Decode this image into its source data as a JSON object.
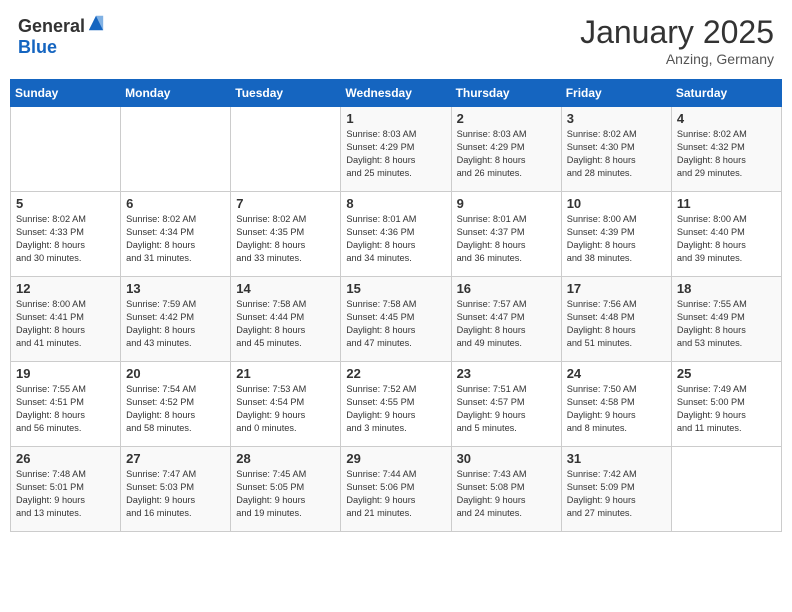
{
  "header": {
    "logo_general": "General",
    "logo_blue": "Blue",
    "month": "January 2025",
    "location": "Anzing, Germany"
  },
  "weekdays": [
    "Sunday",
    "Monday",
    "Tuesday",
    "Wednesday",
    "Thursday",
    "Friday",
    "Saturday"
  ],
  "weeks": [
    [
      {
        "day": "",
        "text": ""
      },
      {
        "day": "",
        "text": ""
      },
      {
        "day": "",
        "text": ""
      },
      {
        "day": "1",
        "text": "Sunrise: 8:03 AM\nSunset: 4:29 PM\nDaylight: 8 hours\nand 25 minutes."
      },
      {
        "day": "2",
        "text": "Sunrise: 8:03 AM\nSunset: 4:29 PM\nDaylight: 8 hours\nand 26 minutes."
      },
      {
        "day": "3",
        "text": "Sunrise: 8:02 AM\nSunset: 4:30 PM\nDaylight: 8 hours\nand 28 minutes."
      },
      {
        "day": "4",
        "text": "Sunrise: 8:02 AM\nSunset: 4:32 PM\nDaylight: 8 hours\nand 29 minutes."
      }
    ],
    [
      {
        "day": "5",
        "text": "Sunrise: 8:02 AM\nSunset: 4:33 PM\nDaylight: 8 hours\nand 30 minutes."
      },
      {
        "day": "6",
        "text": "Sunrise: 8:02 AM\nSunset: 4:34 PM\nDaylight: 8 hours\nand 31 minutes."
      },
      {
        "day": "7",
        "text": "Sunrise: 8:02 AM\nSunset: 4:35 PM\nDaylight: 8 hours\nand 33 minutes."
      },
      {
        "day": "8",
        "text": "Sunrise: 8:01 AM\nSunset: 4:36 PM\nDaylight: 8 hours\nand 34 minutes."
      },
      {
        "day": "9",
        "text": "Sunrise: 8:01 AM\nSunset: 4:37 PM\nDaylight: 8 hours\nand 36 minutes."
      },
      {
        "day": "10",
        "text": "Sunrise: 8:00 AM\nSunset: 4:39 PM\nDaylight: 8 hours\nand 38 minutes."
      },
      {
        "day": "11",
        "text": "Sunrise: 8:00 AM\nSunset: 4:40 PM\nDaylight: 8 hours\nand 39 minutes."
      }
    ],
    [
      {
        "day": "12",
        "text": "Sunrise: 8:00 AM\nSunset: 4:41 PM\nDaylight: 8 hours\nand 41 minutes."
      },
      {
        "day": "13",
        "text": "Sunrise: 7:59 AM\nSunset: 4:42 PM\nDaylight: 8 hours\nand 43 minutes."
      },
      {
        "day": "14",
        "text": "Sunrise: 7:58 AM\nSunset: 4:44 PM\nDaylight: 8 hours\nand 45 minutes."
      },
      {
        "day": "15",
        "text": "Sunrise: 7:58 AM\nSunset: 4:45 PM\nDaylight: 8 hours\nand 47 minutes."
      },
      {
        "day": "16",
        "text": "Sunrise: 7:57 AM\nSunset: 4:47 PM\nDaylight: 8 hours\nand 49 minutes."
      },
      {
        "day": "17",
        "text": "Sunrise: 7:56 AM\nSunset: 4:48 PM\nDaylight: 8 hours\nand 51 minutes."
      },
      {
        "day": "18",
        "text": "Sunrise: 7:55 AM\nSunset: 4:49 PM\nDaylight: 8 hours\nand 53 minutes."
      }
    ],
    [
      {
        "day": "19",
        "text": "Sunrise: 7:55 AM\nSunset: 4:51 PM\nDaylight: 8 hours\nand 56 minutes."
      },
      {
        "day": "20",
        "text": "Sunrise: 7:54 AM\nSunset: 4:52 PM\nDaylight: 8 hours\nand 58 minutes."
      },
      {
        "day": "21",
        "text": "Sunrise: 7:53 AM\nSunset: 4:54 PM\nDaylight: 9 hours\nand 0 minutes."
      },
      {
        "day": "22",
        "text": "Sunrise: 7:52 AM\nSunset: 4:55 PM\nDaylight: 9 hours\nand 3 minutes."
      },
      {
        "day": "23",
        "text": "Sunrise: 7:51 AM\nSunset: 4:57 PM\nDaylight: 9 hours\nand 5 minutes."
      },
      {
        "day": "24",
        "text": "Sunrise: 7:50 AM\nSunset: 4:58 PM\nDaylight: 9 hours\nand 8 minutes."
      },
      {
        "day": "25",
        "text": "Sunrise: 7:49 AM\nSunset: 5:00 PM\nDaylight: 9 hours\nand 11 minutes."
      }
    ],
    [
      {
        "day": "26",
        "text": "Sunrise: 7:48 AM\nSunset: 5:01 PM\nDaylight: 9 hours\nand 13 minutes."
      },
      {
        "day": "27",
        "text": "Sunrise: 7:47 AM\nSunset: 5:03 PM\nDaylight: 9 hours\nand 16 minutes."
      },
      {
        "day": "28",
        "text": "Sunrise: 7:45 AM\nSunset: 5:05 PM\nDaylight: 9 hours\nand 19 minutes."
      },
      {
        "day": "29",
        "text": "Sunrise: 7:44 AM\nSunset: 5:06 PM\nDaylight: 9 hours\nand 21 minutes."
      },
      {
        "day": "30",
        "text": "Sunrise: 7:43 AM\nSunset: 5:08 PM\nDaylight: 9 hours\nand 24 minutes."
      },
      {
        "day": "31",
        "text": "Sunrise: 7:42 AM\nSunset: 5:09 PM\nDaylight: 9 hours\nand 27 minutes."
      },
      {
        "day": "",
        "text": ""
      }
    ]
  ]
}
